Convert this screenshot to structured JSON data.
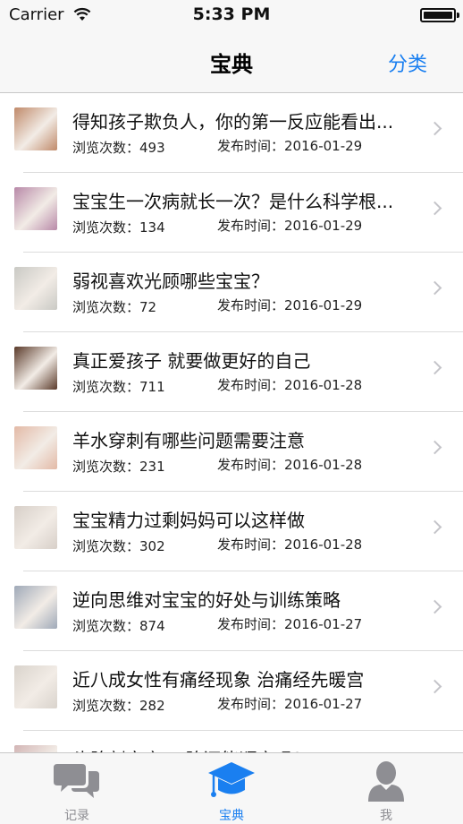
{
  "status_bar": {
    "carrier": "Carrier",
    "time": "5:33 PM"
  },
  "nav": {
    "title": "宝典",
    "action": "分类"
  },
  "articles": [
    {
      "title": "得知孩子欺负人，你的第一反应能看出...",
      "views_label": "浏览次数：",
      "views": "493",
      "date_label": "发布时间：",
      "date": "2016-01-29",
      "thumb_color": "#c08a6a"
    },
    {
      "title": "宝宝生一次病就长一次？是什么科学根...",
      "views_label": "浏览次数：",
      "views": "134",
      "date_label": "发布时间：",
      "date": "2016-01-29",
      "thumb_color": "#b889a8"
    },
    {
      "title": "弱视喜欢光顾哪些宝宝？",
      "views_label": "浏览次数：",
      "views": "72",
      "date_label": "发布时间：",
      "date": "2016-01-29",
      "thumb_color": "#c9c9c4"
    },
    {
      "title": "真正爱孩子 就要做更好的自己",
      "views_label": "浏览次数：",
      "views": "711",
      "date_label": "发布时间：",
      "date": "2016-01-28",
      "thumb_color": "#5a3a2a"
    },
    {
      "title": "羊水穿刺有哪些问题需要注意",
      "views_label": "浏览次数：",
      "views": "231",
      "date_label": "发布时间：",
      "date": "2016-01-28",
      "thumb_color": "#e3b9a6"
    },
    {
      "title": "宝宝精力过剩妈妈可以这样做",
      "views_label": "浏览次数：",
      "views": "302",
      "date_label": "发布时间：",
      "date": "2016-01-28",
      "thumb_color": "#d7cfc8"
    },
    {
      "title": "逆向思维对宝宝的好处与训练策略",
      "views_label": "浏览次数：",
      "views": "874",
      "date_label": "发布时间：",
      "date": "2016-01-27",
      "thumb_color": "#9fa9b8"
    },
    {
      "title": "近八成女性有痛经现象 治痛经先暖宫",
      "views_label": "浏览次数：",
      "views": "282",
      "date_label": "发布时间：",
      "date": "2016-01-27",
      "thumb_color": "#d9d3cc"
    },
    {
      "title": "头胎剖宫产 二胎还能顺产吗?",
      "views_label": "",
      "views": "",
      "date_label": "",
      "date": "",
      "thumb_color": "#d2b5b5"
    }
  ],
  "tabs": [
    {
      "label": "记录",
      "icon": "chat-bubbles-icon",
      "active": false
    },
    {
      "label": "宝典",
      "icon": "graduation-cap-icon",
      "active": true
    },
    {
      "label": "我",
      "icon": "person-icon",
      "active": false
    }
  ],
  "colors": {
    "accent": "#1a7ff0",
    "inactive": "#8e8e93",
    "bar_bg": "#f7f7f7"
  }
}
